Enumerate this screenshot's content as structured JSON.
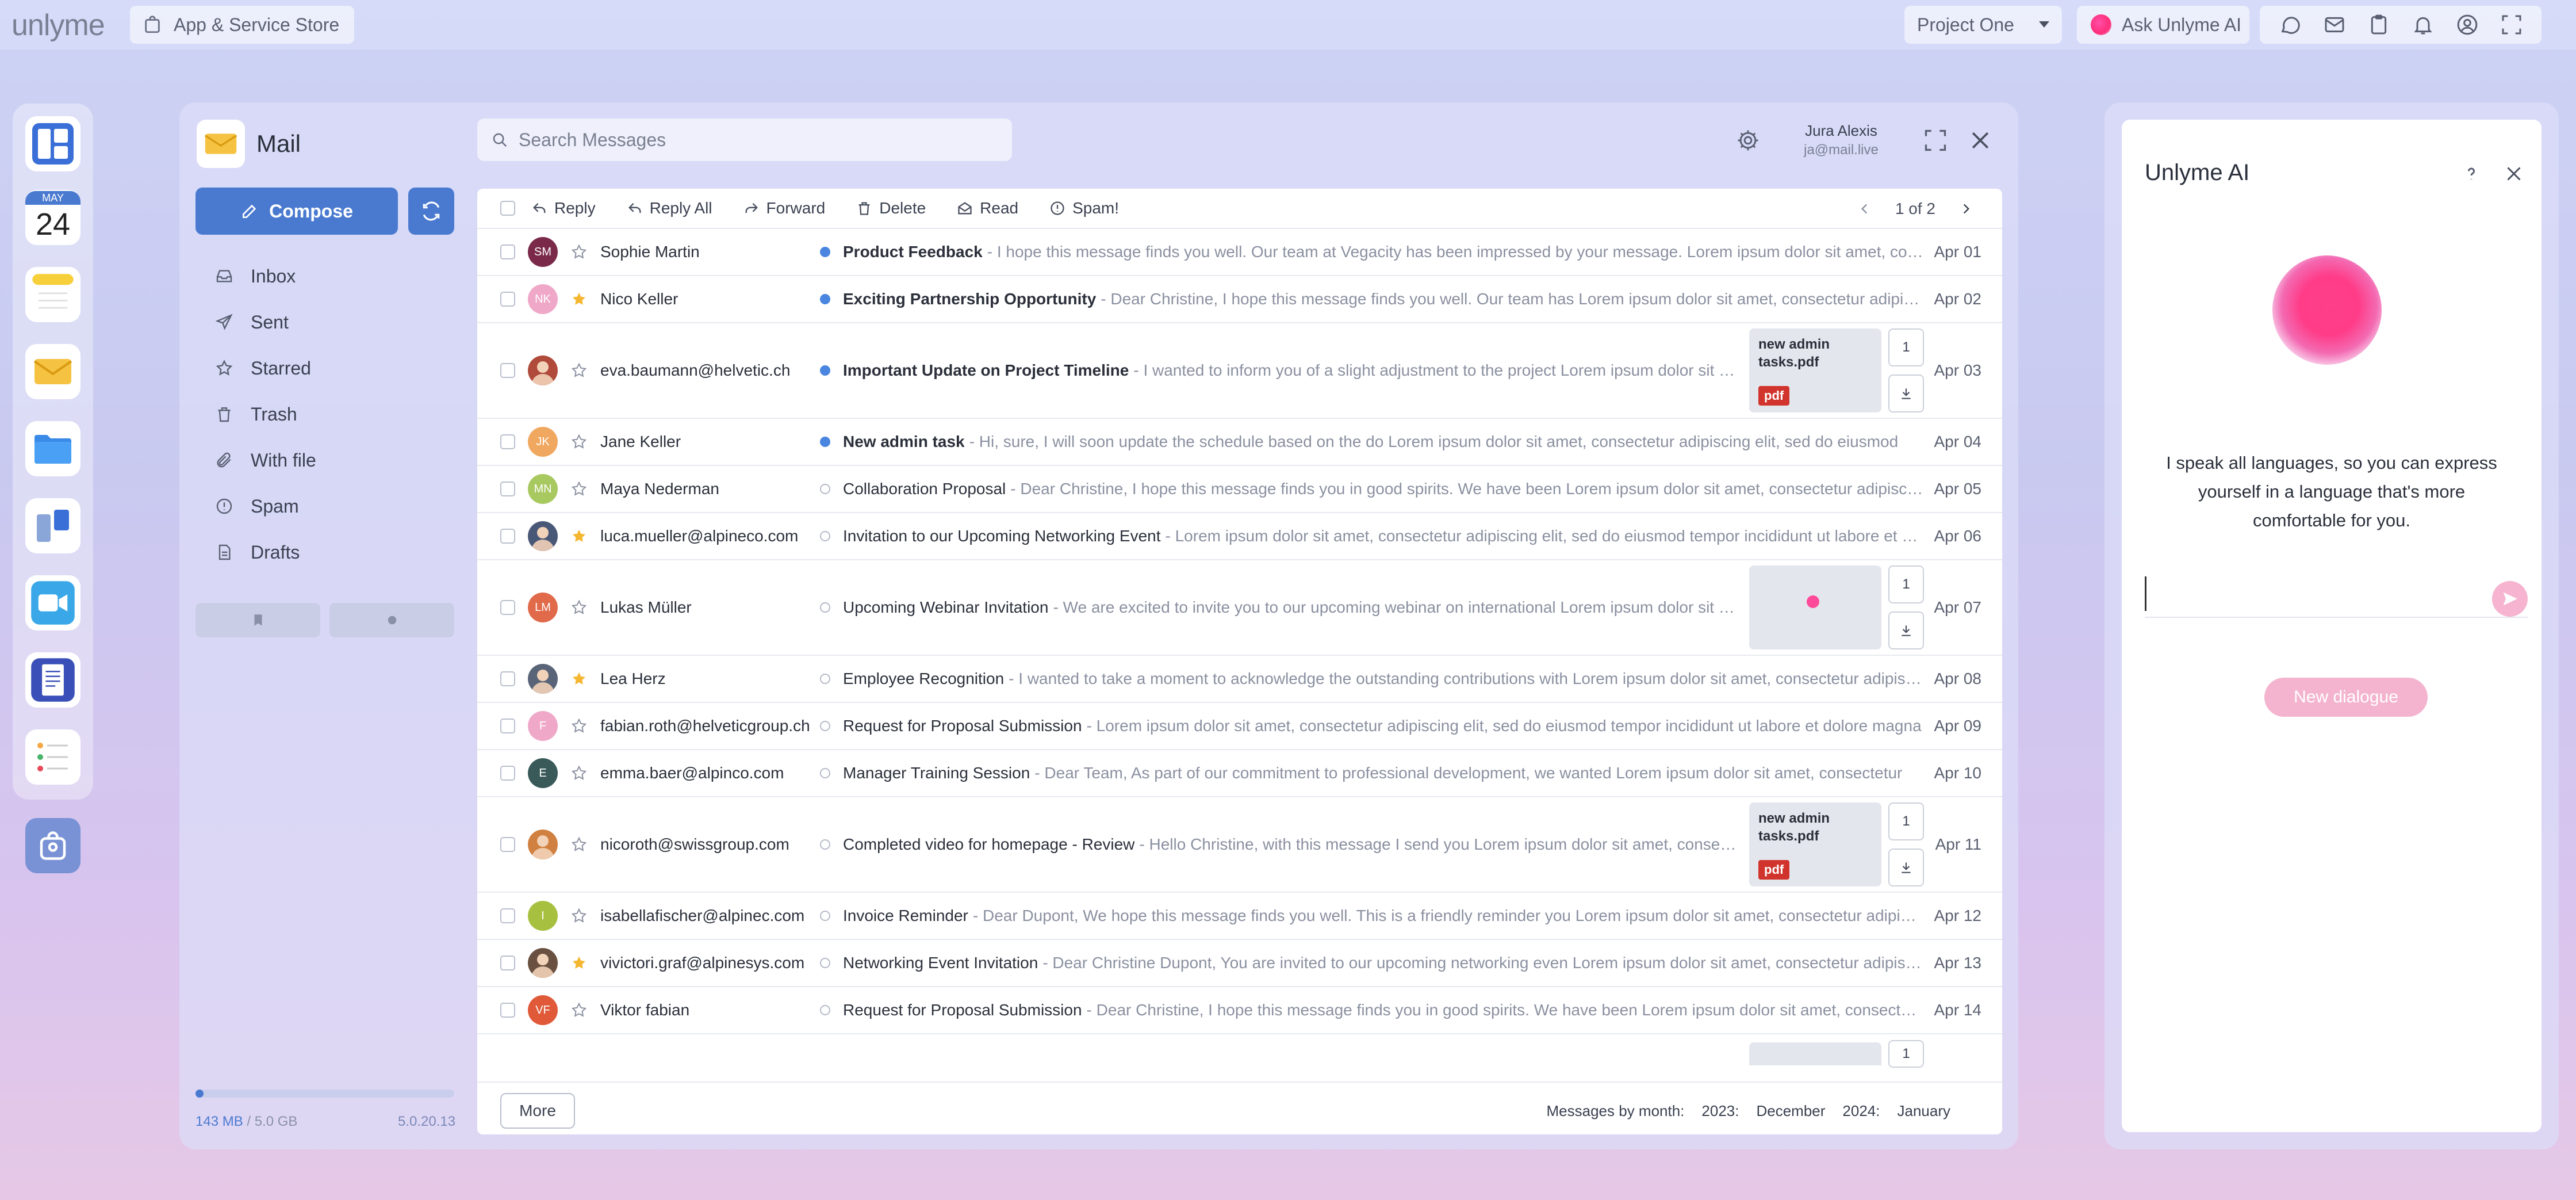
{
  "topbar": {
    "logo": "unlyme",
    "store_label": "App & Service Store",
    "project": "Project One",
    "ask_ai": "Ask Unlyme AI"
  },
  "dock": {
    "calendar_month": "MAY",
    "calendar_day": "24"
  },
  "mail": {
    "title": "Mail",
    "compose": "Compose",
    "search_placeholder": "Search Messages",
    "user_name": "Jura Alexis",
    "user_email": "ja@mail.live",
    "folders": [
      "Inbox",
      "Sent",
      "Starred",
      "Trash",
      "With file",
      "Spam",
      "Drafts"
    ],
    "storage_used": "143 MB",
    "storage_total": "/ 5.0 GB",
    "storage_fraction": 0.03,
    "version": "5.0.20.13",
    "toolbar": {
      "reply": "Reply",
      "reply_all": "Reply All",
      "forward": "Forward",
      "delete": "Delete",
      "read": "Read",
      "spam": "Spam!",
      "pager": "1 of 2"
    },
    "footer": {
      "more": "More",
      "by_month": "Messages by month:",
      "y2023": "2023:",
      "m2023": "December",
      "y2024": "2024:",
      "m2024": "January"
    },
    "messages": [
      {
        "sender": "Sophie Martin",
        "initials": "SM",
        "avatar_color": "#7a2a48",
        "starred": false,
        "unread": true,
        "subject": "Product Feedback",
        "preview": "I hope this message finds you well. Our team at Vegacity has been impressed by your message. Lorem ipsum dolor sit amet, consectetur adipiscing elit",
        "date": "Apr 01",
        "attachment": null
      },
      {
        "sender": "Nico Keller",
        "initials": "NK",
        "avatar_color": "#f0a8c8",
        "starred": true,
        "unread": true,
        "subject": "Exciting Partnership Opportunity",
        "preview": "Dear Christine, I hope this message finds you well. Our team has Lorem ipsum dolor sit amet, consectetur adipiscing elit",
        "date": "Apr 02",
        "attachment": null
      },
      {
        "sender": "eva.baumann@helvetic.ch",
        "initials": "",
        "avatar_color": "#b04a3a",
        "starred": false,
        "unread": true,
        "subject": "Important Update on Project Timeline",
        "preview": "I wanted to inform you of a slight adjustment to the project Lorem ipsum dolor sit amet",
        "date": "Apr 03",
        "attachment": {
          "kind": "pdf",
          "name": "new admin tasks.pdf",
          "badge": "pdf",
          "count": "1"
        }
      },
      {
        "sender": "Jane Keller",
        "initials": "JK",
        "avatar_color": "#f0a860",
        "starred": false,
        "unread": true,
        "subject": "New admin task",
        "preview": "Hi, sure, I will soon update the schedule based on the do Lorem ipsum dolor sit amet, consectetur adipiscing elit, sed do eiusmod",
        "date": "Apr 04",
        "attachment": null
      },
      {
        "sender": "Maya Nederman",
        "initials": "MN",
        "avatar_color": "#a8c860",
        "starred": false,
        "unread": false,
        "subject": "Collaboration Proposal",
        "preview": "Dear Christine, I hope this message finds you in good spirits. We have been Lorem ipsum dolor sit amet, consectetur adipiscing elit",
        "date": "Apr 05",
        "attachment": null
      },
      {
        "sender": "luca.mueller@alpineco.com",
        "initials": "",
        "avatar_color": "#4a5878",
        "starred": true,
        "unread": false,
        "subject": "Invitation to our Upcoming Networking Event",
        "preview": "Lorem ipsum dolor sit amet, consectetur adipiscing elit, sed do eiusmod tempor incididunt ut labore et dolore",
        "date": "Apr 06",
        "attachment": null
      },
      {
        "sender": "Lukas Müller",
        "initials": "LM",
        "avatar_color": "#e06a4a",
        "starred": false,
        "unread": false,
        "subject": "Upcoming Webinar Invitation",
        "preview": "We are excited to invite you to our upcoming webinar on international Lorem ipsum dolor sit amet",
        "date": "Apr 07",
        "attachment": {
          "kind": "image",
          "name": "",
          "badge": "",
          "count": "1"
        }
      },
      {
        "sender": "Lea Herz",
        "initials": "",
        "avatar_color": "#5a6478",
        "starred": true,
        "unread": false,
        "subject": "Employee Recognition",
        "preview": "I wanted to take a moment to acknowledge the outstanding contributions with Lorem ipsum dolor sit amet, consectetur adipiscing elit",
        "date": "Apr 08",
        "attachment": null
      },
      {
        "sender": "fabian.roth@helveticgroup.ch",
        "initials": "F",
        "avatar_color": "#f0a8c8",
        "starred": false,
        "unread": false,
        "subject": "Request for Proposal Submission",
        "preview": "Lorem ipsum dolor sit amet, consectetur adipiscing elit, sed do eiusmod tempor incididunt ut labore et dolore magna",
        "date": "Apr 09",
        "attachment": null
      },
      {
        "sender": "emma.baer@alpinco.com",
        "initials": "E",
        "avatar_color": "#3a5a5a",
        "starred": false,
        "unread": false,
        "subject": "Manager Training Session",
        "preview": "Dear Team, As part of our commitment to professional development, we wanted Lorem ipsum dolor sit amet, consectetur",
        "date": "Apr 10",
        "attachment": null
      },
      {
        "sender": "nicoroth@swissgroup.com",
        "initials": "",
        "avatar_color": "#d08040",
        "starred": false,
        "unread": false,
        "subject": "Completed video for homepage - Review",
        "preview": "Hello Christine, with this message I send you Lorem ipsum dolor sit amet, consectetur",
        "date": "Apr 11",
        "attachment": {
          "kind": "pdf",
          "name": "new admin tasks.pdf",
          "badge": "pdf",
          "count": "1"
        }
      },
      {
        "sender": "isabellafischer@alpinec.com",
        "initials": "I",
        "avatar_color": "#a8c040",
        "starred": false,
        "unread": false,
        "subject": "Invoice Reminder",
        "preview": "Dear Dupont, We hope this message finds you well. This is a friendly reminder you Lorem ipsum dolor sit amet, consectetur adipiscing elit",
        "date": "Apr 12",
        "attachment": null
      },
      {
        "sender": "vivictori.graf@alpinesys.com",
        "initials": "",
        "avatar_color": "#6a5040",
        "starred": true,
        "unread": false,
        "subject": "Networking Event Invitation",
        "preview": "Dear Christine Dupont, You are invited to our upcoming networking even Lorem ipsum dolor sit amet, consectetur adipiscing",
        "date": "Apr 13",
        "attachment": null
      },
      {
        "sender": "Viktor fabian",
        "initials": "VF",
        "avatar_color": "#e05a3a",
        "starred": false,
        "unread": false,
        "subject": "Request for Proposal Submission",
        "preview": "Dear Christine, I hope this message finds you in good spirits. We have been Lorem ipsum dolor sit amet, consectetur adipiscing elit",
        "date": "Apr 14",
        "attachment": null
      }
    ],
    "partial_row_count": "1"
  },
  "ai": {
    "title": "Unlyme AI",
    "message": "I speak all languages, so you can express yourself in a language that's more comfortable for you.",
    "new_dialogue": "New dialogue"
  },
  "colors": {
    "accent": "#4a7ad0",
    "unread_dot": "#4a86e0",
    "star": "#f5b731",
    "ai_pink": "#ff3f8a"
  }
}
